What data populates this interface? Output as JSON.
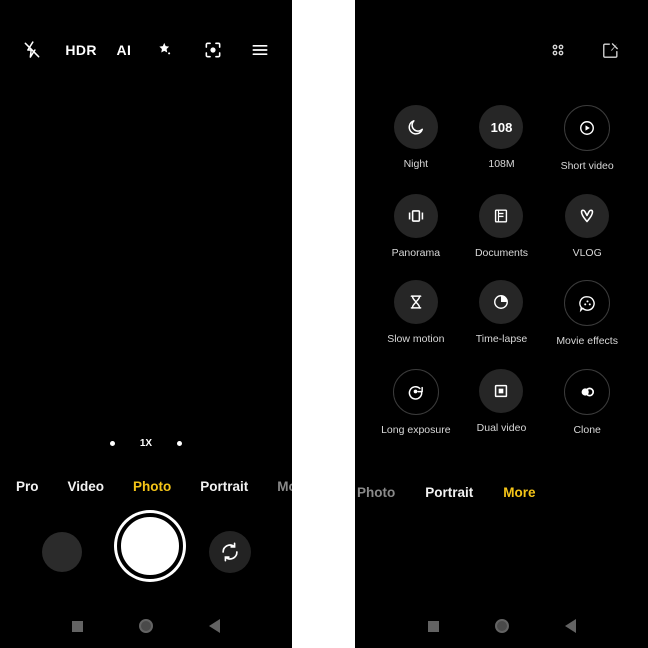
{
  "viewfinder": {
    "topbar": [
      {
        "name": "flash-off-icon",
        "label": "",
        "type": "icon"
      },
      {
        "name": "hdr-button",
        "label": "HDR",
        "type": "text"
      },
      {
        "name": "ai-button",
        "label": "AI",
        "type": "text"
      },
      {
        "name": "beautify-wand-icon",
        "label": "",
        "type": "icon"
      },
      {
        "name": "google-lens-icon",
        "label": "",
        "type": "icon"
      },
      {
        "name": "menu-icon",
        "label": "",
        "type": "icon"
      }
    ],
    "zoom": {
      "level_label": "1X"
    },
    "mode_tabs": [
      {
        "label": "Pro",
        "state": "inactive"
      },
      {
        "label": "Video",
        "state": "inactive"
      },
      {
        "label": "Photo",
        "state": "active"
      },
      {
        "label": "Portrait",
        "state": "inactive"
      },
      {
        "label": "More",
        "state": "dim"
      }
    ],
    "controls": {
      "gallery_thumbnail": "gallery-thumbnail",
      "shutter": "shutter-button",
      "switch_camera": "switch-camera-button"
    }
  },
  "more_screen": {
    "topbar": [
      {
        "name": "grid-layout-icon",
        "label": ""
      },
      {
        "name": "edit-modes-icon",
        "label": ""
      }
    ],
    "modes": [
      {
        "label": "Night",
        "icon": "moon-icon",
        "style": "filled"
      },
      {
        "label": "108M",
        "icon": "megapixel-108-icon",
        "style": "filled"
      },
      {
        "label": "Short video",
        "icon": "play-circle-icon",
        "style": "outlined"
      },
      {
        "label": "Panorama",
        "icon": "panorama-icon",
        "style": "filled"
      },
      {
        "label": "Documents",
        "icon": "document-icon",
        "style": "filled"
      },
      {
        "label": "VLOG",
        "icon": "vlog-icon",
        "style": "filled"
      },
      {
        "label": "Slow motion",
        "icon": "hourglass-icon",
        "style": "filled"
      },
      {
        "label": "Time-lapse",
        "icon": "timelapse-clock-icon",
        "style": "filled"
      },
      {
        "label": "Movie effects",
        "icon": "movie-effects-icon",
        "style": "outlined"
      },
      {
        "label": "Long exposure",
        "icon": "long-exposure-icon",
        "style": "outlined"
      },
      {
        "label": "Dual video",
        "icon": "dual-video-icon",
        "style": "filled"
      },
      {
        "label": "Clone",
        "icon": "clone-icon",
        "style": "outlined"
      }
    ],
    "mode_tabs": [
      {
        "label": "Photo",
        "state": "dim"
      },
      {
        "label": "Portrait",
        "state": "inactive"
      },
      {
        "label": "More",
        "state": "active"
      }
    ]
  },
  "navbar": {
    "recents": "recents-square-button",
    "home": "home-circle-button",
    "back": "back-triangle-button"
  },
  "colors": {
    "accent": "#f5c518",
    "background": "#000000",
    "gap": "#ffffff",
    "circle_fill": "#262626",
    "nav_icon": "#636363"
  }
}
